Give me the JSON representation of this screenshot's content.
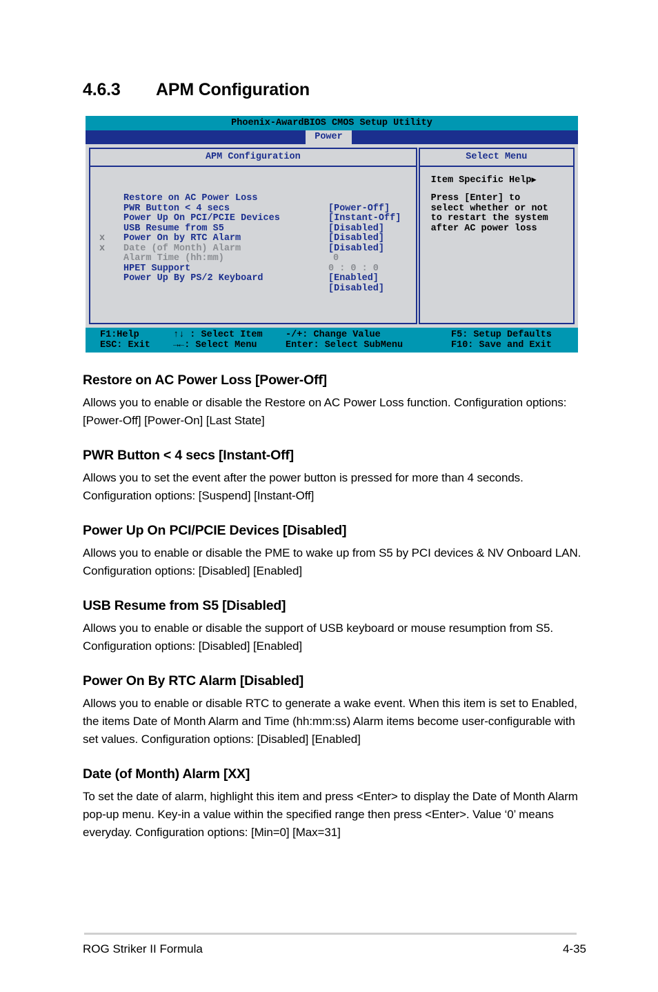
{
  "document": {
    "section_number": "4.6.3",
    "section_title": "APM Configuration"
  },
  "bios": {
    "title": "Phoenix-AwardBIOS CMOS Setup Utility",
    "active_tab": "Power",
    "left_panel_title": "APM Configuration",
    "right_panel_title": "Select Menu",
    "items": [
      {
        "mark": "",
        "label": "Restore on AC Power Loss",
        "value": "[Power-Off]",
        "dim": false
      },
      {
        "mark": "",
        "label": "PWR Button < 4 secs",
        "value": "[Instant-Off]",
        "dim": false
      },
      {
        "mark": "",
        "label": "Power Up On PCI/PCIE Devices",
        "value": "[Disabled]",
        "dim": false
      },
      {
        "mark": "",
        "label": "USB Resume from S5",
        "value": "[Disabled]",
        "dim": false
      },
      {
        "mark": "",
        "label": "Power On by RTC Alarm",
        "value": "[Disabled]",
        "dim": false
      },
      {
        "mark": "x",
        "label": "Date (of Month) Alarm",
        "value": "0",
        "dim": true
      },
      {
        "mark": "x",
        "label": "Alarm Time (hh:mm)",
        "value": "0 : 0 : 0",
        "dim": true
      },
      {
        "mark": "",
        "label": "HPET Support",
        "value": "[Enabled]",
        "dim": false
      },
      {
        "mark": "",
        "label": "Power Up By PS/2 Keyboard",
        "value": "[Disabled]",
        "dim": false
      }
    ],
    "help": {
      "title": "Item Specific Help",
      "arrow": "▶",
      "lines": "Press [Enter] to\nselect whether or not\nto restart the system\nafter AC power loss"
    },
    "keys": {
      "r1c1": "F1:Help",
      "r1c2": "↑↓ : Select Item",
      "r1c3": "-/+: Change Value",
      "r1c4": "F5: Setup Defaults",
      "r2c1": "ESC: Exit",
      "r2c2": "→←: Select Menu",
      "r2c3": "Enter: Select SubMenu",
      "r2c4": "F10: Save and Exit"
    },
    "colors": {
      "title_bar": "#0097b2",
      "tab_bar": "#1b2f8e",
      "panel_bg": "#d3d5d8",
      "panel_border": "#1b2f8e",
      "item_text": "#1b2f8e",
      "dim_text": "#8a8d92"
    }
  },
  "sections": [
    {
      "heading": "Restore on AC Power Loss [Power-Off]",
      "body": "Allows you to enable or disable the Restore on AC Power Loss function. Configuration options: [Power-Off] [Power-On] [Last State]"
    },
    {
      "heading": "PWR Button < 4 secs [Instant-Off]",
      "body": "Allows you to set the event after the power button is pressed for more than 4 seconds. Configuration options: [Suspend] [Instant-Off]"
    },
    {
      "heading": "Power Up On PCI/PCIE Devices [Disabled]",
      "body": "Allows you to enable or disable the PME to wake up from S5 by PCI devices & NV Onboard LAN. Configuration options: [Disabled] [Enabled]"
    },
    {
      "heading": "USB Resume from S5 [Disabled]",
      "body": "Allows you to enable or disable the support of USB keyboard or mouse resumption from S5. Configuration options: [Disabled] [Enabled]"
    },
    {
      "heading": "Power On By RTC Alarm [Disabled]",
      "body": "Allows you to enable or disable RTC to generate a wake event. When this item is set to Enabled, the items Date of Month Alarm and Time (hh:mm:ss) Alarm items become user-configurable with set values.\nConfiguration options: [Disabled] [Enabled]"
    },
    {
      "heading": "Date (of Month) Alarm [XX]",
      "body": "To set the date of alarm, highlight this item and press <Enter> to display the Date of Month Alarm pop-up menu. Key-in a value within the specified range then press <Enter>. Value ‘0’ means everyday. Configuration options: [Min=0] [Max=31]"
    }
  ],
  "footer": {
    "product": "ROG Striker II Formula",
    "page_number": "4-35"
  }
}
